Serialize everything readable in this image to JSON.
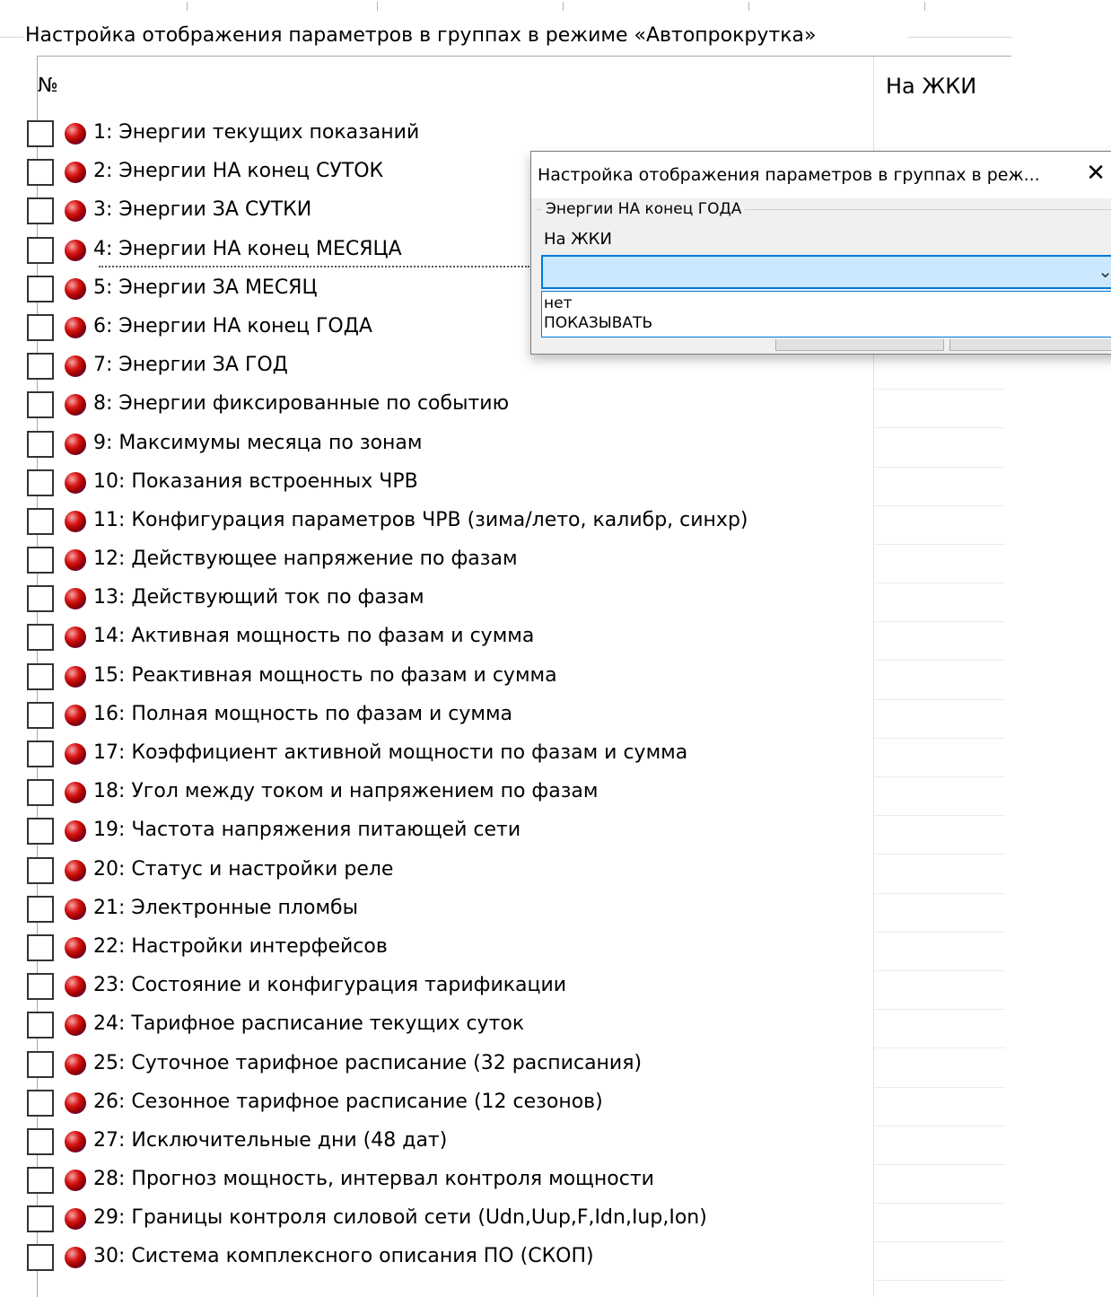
{
  "group": {
    "title": "Настройка отображения параметров в группах в режиме «Автопрокрутка»"
  },
  "table": {
    "col_num": "№",
    "col_lcd": "На ЖКИ",
    "rows": [
      "1: Энергии текущих показаний",
      "2: Энергии НА конец СУТОК",
      "3: Энергии ЗА СУТКИ",
      "4: Энергии НА конец МЕСЯЦА",
      "5: Энергии ЗА МЕСЯЦ",
      "6: Энергии НА конец ГОДА",
      "7: Энергии ЗА ГОД",
      "8: Энергии фиксированные по событию",
      "9: Максимумы месяца по зонам",
      "10: Показания встроенных ЧРВ",
      "11: Конфигурация параметров ЧРВ (зима/лето, калибр, синхр)",
      "12: Действующее напряжение по фазам",
      "13: Действующий ток по фазам",
      "14: Активная мощность по фазам и сумма",
      "15: Реактивная мощность по фазам и сумма",
      "16: Полная мощность по фазам и сумма",
      "17: Коэффициент активной мощности по фазам и сумма",
      "18: Угол между током и напряжением по фазам",
      "19: Частота напряжения питающей сети",
      "20: Статус и настройки реле",
      "21: Электронные пломбы",
      "22: Настройки интерфейсов",
      "23: Состояние и конфигурация тарификации",
      "24: Тарифное расписание текущих суток",
      "25: Суточное тарифное расписание (32 расписания)",
      "26: Сезонное тарифное расписание (12 сезонов)",
      "27: Исключительные дни (48 дат)",
      "28: Прогноз мощность, интервал контроля мощности",
      "29: Границы контроля силовой сети (Udn,Uup,F,Idn,Iup,Ion)",
      "30: Система комплексного описания ПО (СКОП)"
    ],
    "row_icon": "red-blue-ball-icon"
  },
  "dialog": {
    "title": "Настройка отображения параметров в группах в реж...",
    "close_glyph": "✕",
    "group_title": "Энергии НА конец ГОДА",
    "field_label": "На ЖКИ",
    "combo_value": "",
    "options": [
      "нет",
      "ПОКАЗЫВАТЬ"
    ]
  },
  "colors": {
    "selection": "#cce8ff",
    "focus_border": "#0078d7",
    "dialog_bg": "#f0f0f0"
  }
}
